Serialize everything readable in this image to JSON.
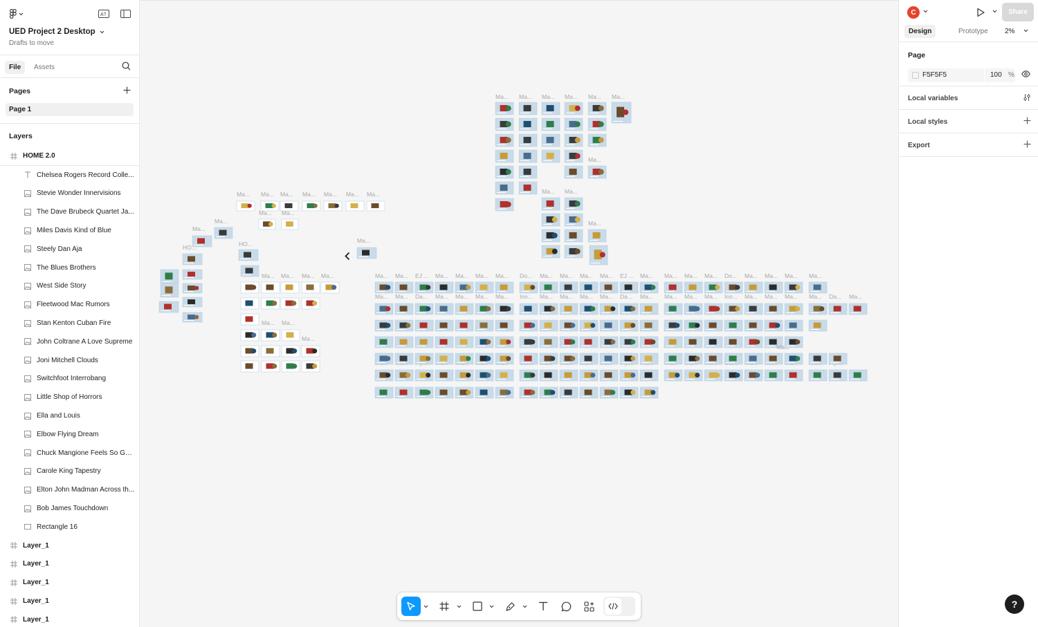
{
  "file": {
    "title": "UED Project 2 Desktop",
    "location": "Drafts to move"
  },
  "left_tabs": {
    "file": "File",
    "assets": "Assets"
  },
  "pages": {
    "heading": "Pages",
    "items": [
      "Page 1"
    ]
  },
  "layers": {
    "heading": "Layers",
    "frame": "HOME 2.0",
    "children": [
      {
        "type": "text",
        "label": "Chelsea Rogers Record Colle..."
      },
      {
        "type": "image",
        "label": "Stevie Wonder Innervisions"
      },
      {
        "type": "image",
        "label": "The Dave Brubeck Quartet Ja..."
      },
      {
        "type": "image",
        "label": "Miles Davis Kind of Blue"
      },
      {
        "type": "image",
        "label": "Steely Dan Aja"
      },
      {
        "type": "image",
        "label": "The Blues Brothers"
      },
      {
        "type": "image",
        "label": "West Side Story"
      },
      {
        "type": "image",
        "label": "Fleetwood Mac Rumors"
      },
      {
        "type": "image",
        "label": "Stan Kenton Cuban Fire"
      },
      {
        "type": "image",
        "label": "John Coltrane A Love Supreme"
      },
      {
        "type": "image",
        "label": "Joni Mitchell Clouds"
      },
      {
        "type": "image",
        "label": "Switchfoot Interrobang"
      },
      {
        "type": "image",
        "label": "Little Shop of Horrors"
      },
      {
        "type": "image",
        "label": "Ella and Louis"
      },
      {
        "type": "image",
        "label": "Elbow Flying Dream"
      },
      {
        "type": "image",
        "label": "Chuck Mangione Feels So Good"
      },
      {
        "type": "image",
        "label": "Carole King Tapestry"
      },
      {
        "type": "image",
        "label": "Elton John Madman Across th..."
      },
      {
        "type": "image",
        "label": "Bob James Touchdown"
      },
      {
        "type": "rect",
        "label": "Rectangle 16"
      }
    ],
    "siblings": [
      "Layer_1",
      "Layer_1",
      "Layer_1",
      "Layer_1",
      "Layer_1"
    ]
  },
  "right": {
    "avatar_initial": "C",
    "share": "Share",
    "tabs": {
      "design": "Design",
      "prototype": "Prototype"
    },
    "zoom": "2%",
    "page": {
      "heading": "Page",
      "fill_hex": "F5F5F5",
      "opacity": "100",
      "opacity_unit": "%"
    },
    "sections": [
      "Local variables",
      "Local styles",
      "Export"
    ]
  },
  "canvas": {
    "background": "#f5f5f5",
    "frame_labels": {
      "ma": "Ma...",
      "ho": "HO...",
      "misc": [
        "All ...",
        "Car...",
        "EJ ...",
        "Da...",
        "En...",
        "Sh...",
        "Flyl...",
        "Do...",
        "Inn...",
        "MC..."
      ]
    }
  },
  "help": "?"
}
